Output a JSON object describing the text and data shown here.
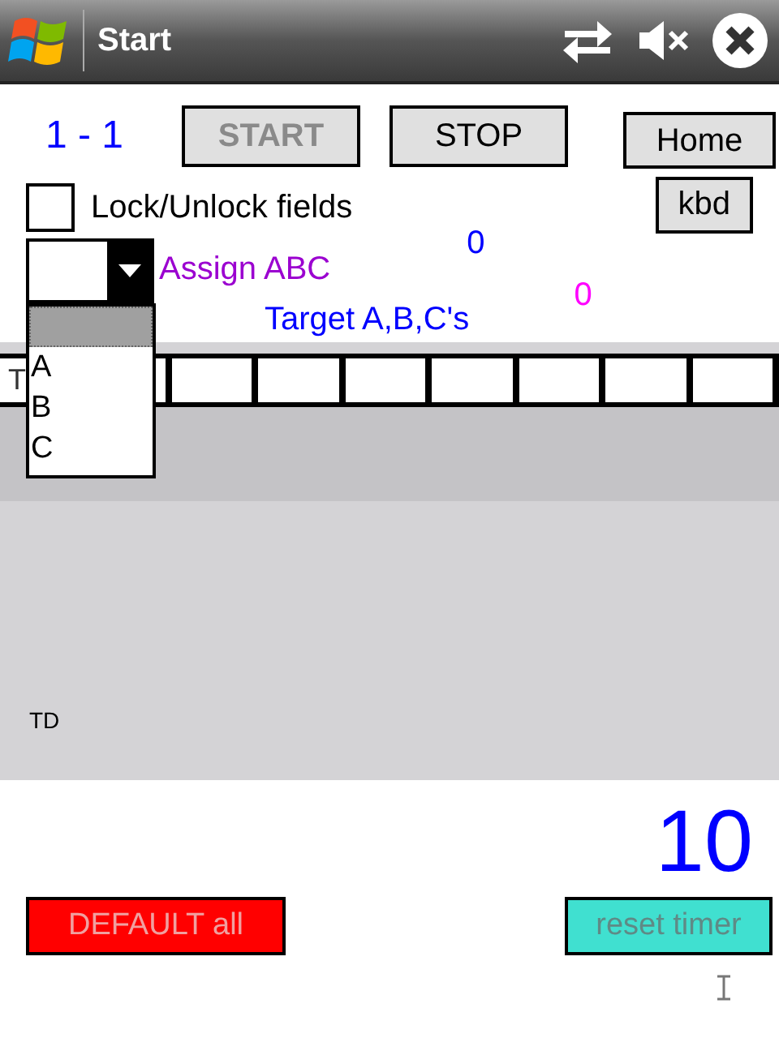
{
  "window": {
    "title": "Start"
  },
  "counter": "1 - 1",
  "buttons": [
    {
      "label": "START",
      "disabled": true
    },
    {
      "label": "STOP",
      "disabled": false
    }
  ],
  "home_button": "Home",
  "kbd_button": "kbd",
  "lock_checkbox": {
    "label": "Lock/Unlock fields",
    "checked": false
  },
  "assign_dropdown": {
    "label": "Assign ABC",
    "expanded": true,
    "options": [
      "A",
      "B",
      "C"
    ]
  },
  "count_a": "0",
  "count_b": "0",
  "target_label": "Target A,B,C's",
  "grid": {
    "first_cell": "T"
  },
  "td_label": "TD",
  "timer": "10",
  "default_button": "DEFAULT all",
  "reset_button": "reset timer"
}
